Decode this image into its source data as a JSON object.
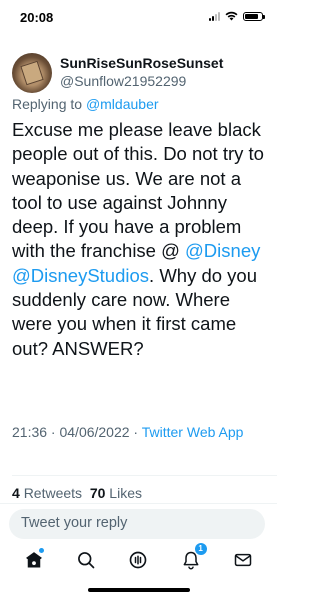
{
  "status_bar": {
    "time": "20:08"
  },
  "tweet": {
    "display_name": "SunRiseSunRoseSunset",
    "handle": "@Sunflow21952299",
    "replying_prefix": "Replying to ",
    "replying_to": "@mldauber",
    "body_part1": "Excuse me please leave black people out of this. Do not try to weaponise us. We are not a tool to use against Johnny deep. If you have a problem with the franchise @ ",
    "mention_disney": "@Disney",
    "mention_disney_studios": "@DisneyStudios",
    "body_part2": ". Why do you suddenly care now. Where were you when it first came out? ANSWER?",
    "timestamp": "21:36 · 04/06/2022 · ",
    "source": "Twitter Web App"
  },
  "stats": {
    "retweets_count": "4",
    "retweets_label": "Retweets",
    "likes_count": "70",
    "likes_label": "Likes"
  },
  "reply": {
    "placeholder": "Tweet your reply"
  },
  "nav": {
    "notifications_badge": "1",
    "items": [
      "home-icon",
      "search-icon",
      "spaces-icon",
      "notifications-icon",
      "messages-icon"
    ]
  },
  "colors": {
    "accent": "#1d9bf0",
    "secondary_text": "#536471",
    "primary_text": "#0f1419"
  }
}
